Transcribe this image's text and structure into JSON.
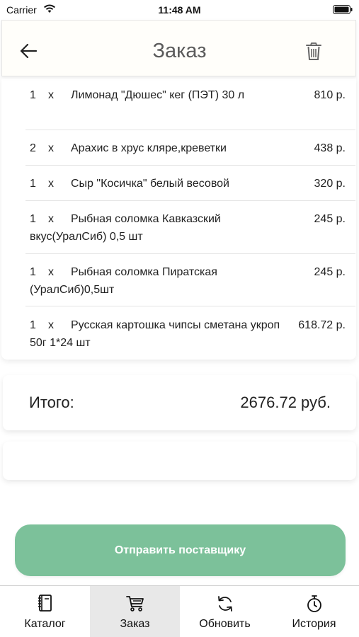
{
  "status_bar": {
    "carrier": "Carrier",
    "time": "11:48 AM"
  },
  "header": {
    "title": "Заказ",
    "back_icon": "arrow-left-icon",
    "delete_icon": "trash-icon"
  },
  "order": {
    "items": [
      {
        "qty": "1",
        "x": "x",
        "name": "Лимонад \"Дюшес\" кег (ПЭТ) 30 л",
        "price": "810 р."
      },
      {
        "qty": "2",
        "x": "x",
        "name": "Арахис в хрус кляре,креветки",
        "price": "438 р."
      },
      {
        "qty": "1",
        "x": "x",
        "name": "Сыр \"Косичка\" белый весовой",
        "price": "320 р."
      },
      {
        "qty": "1",
        "x": "x",
        "name": "Рыбная соломка Кавказский вкус(УралСиб) 0,5 шт",
        "price": "245 р."
      },
      {
        "qty": "1",
        "x": "x",
        "name": "Рыбная соломка Пиратская (УралСиб)0,5шт",
        "price": "245 р."
      },
      {
        "qty": "1",
        "x": "x",
        "name": "Русская картошка чипсы сметана укроп 50г 1*24 шт",
        "price": "618.72 р."
      }
    ]
  },
  "total": {
    "label": "Итого:",
    "value": "2676.72 руб."
  },
  "send_button": {
    "label": "Отправить поставщику",
    "color": "#7cc19a"
  },
  "tab_bar": {
    "tabs": [
      {
        "label": "Каталог",
        "icon": "catalog-book-icon",
        "active": false
      },
      {
        "label": "Заказ",
        "icon": "cart-icon",
        "active": true
      },
      {
        "label": "Обновить",
        "icon": "refresh-icon",
        "active": false
      },
      {
        "label": "История",
        "icon": "stopwatch-icon",
        "active": false
      }
    ]
  }
}
